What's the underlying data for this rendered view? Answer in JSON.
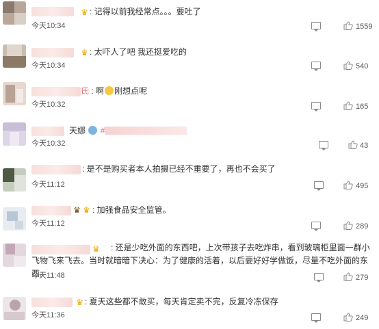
{
  "comments": [
    {
      "text": ": 记得以前我经常点。。。要吐了",
      "time": "今天10:34",
      "likes": "1559"
    },
    {
      "text": ": 太吓人了吧 我还挺爱吃的",
      "time": "今天10:34",
      "likes": "540"
    },
    {
      "text_a": "啊",
      "text_b": "刚想点呢",
      "prefix": ":",
      "time": "今天10:32",
      "likes": "165"
    },
    {
      "text": "天娜",
      "hash": "#",
      "time": "今天10:32",
      "likes": "43"
    },
    {
      "text": ": 是不是购买者本人拍摄已经不重要了，再也不会买了",
      "time": "今天11:12",
      "likes": "495"
    },
    {
      "text": ": 加强食品安全监管。",
      "time": "今天11:12",
      "likes": "289"
    },
    {
      "text": ": 还是少吃外面的东西吧，上次带孩子去吃炸串，看到玻璃柜里面一群小飞物飞来飞去。当时就暗暗下决心：为了健康的活着，以后要好好学做饭，尽量不吃外面的东西。",
      "time": "今天11:48",
      "likes": "279"
    },
    {
      "text": ": 夏天这些都不敢买，每天肯定卖不完，反复冷冻保存",
      "time": "今天11:36",
      "likes": "249"
    }
  ],
  "icons": {
    "reply": "comment-icon",
    "like": "thumbs-up-icon",
    "vip": "crown-icon",
    "emoji": "crying-face-icon"
  }
}
